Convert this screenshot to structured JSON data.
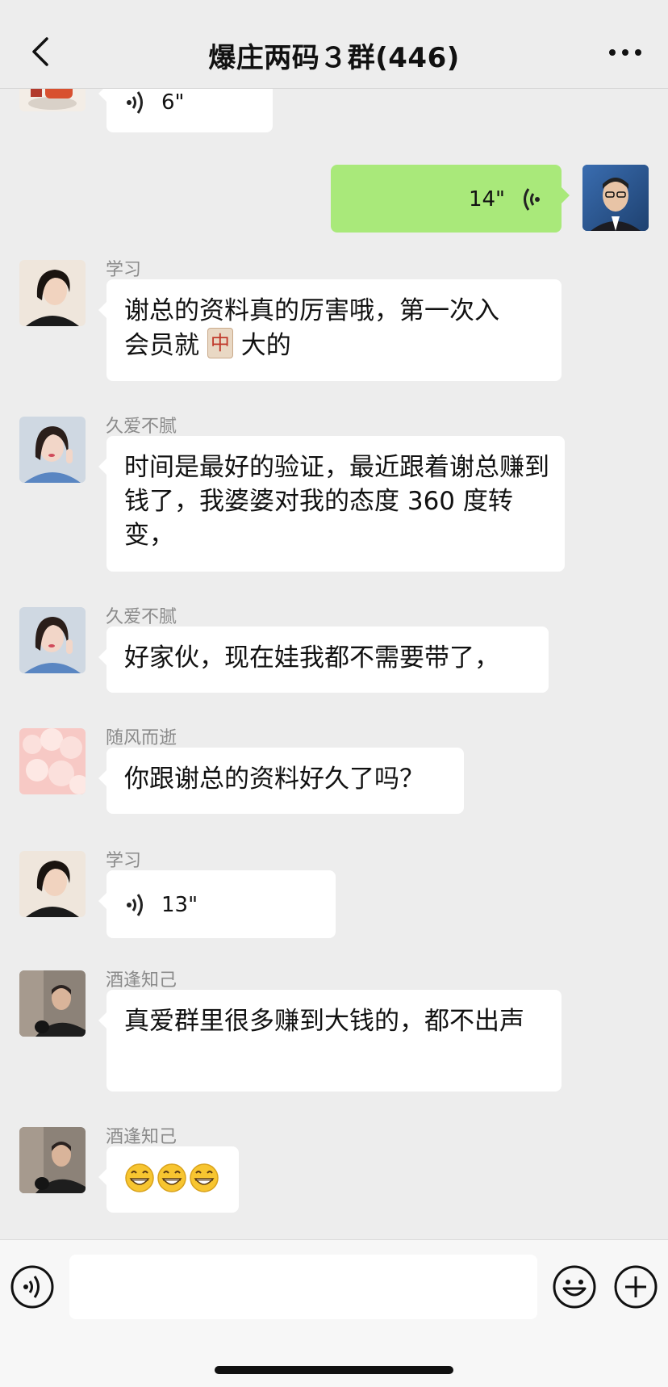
{
  "header": {
    "title": "爆庄两码３群(446)",
    "back_icon": "chevron-left-icon",
    "more_icon": "ellipsis-icon"
  },
  "messages": [
    {
      "type": "voice",
      "side": "left",
      "sender": "",
      "duration": "6\""
    },
    {
      "type": "voice",
      "side": "right",
      "sender": "",
      "duration": "14\""
    },
    {
      "type": "text",
      "side": "left",
      "sender": "学习",
      "line1": "谢总的资料真的厉害哦，第一次入",
      "line2_pre": "会员就",
      "tile": "中",
      "line2_post": "大的"
    },
    {
      "type": "text",
      "side": "left",
      "sender": "久爱不腻",
      "text": "时间是最好的验证，最近跟着谢总赚到钱了，我婆婆对我的态度 360 度转变，"
    },
    {
      "type": "text",
      "side": "left",
      "sender": "久爱不腻",
      "text": "好家伙，现在娃我都不需要带了，"
    },
    {
      "type": "text",
      "side": "left",
      "sender": "随风而逝",
      "text": "你跟谢总的资料好久了吗？"
    },
    {
      "type": "voice",
      "side": "left",
      "sender": "学习",
      "duration": "13\""
    },
    {
      "type": "text",
      "side": "left",
      "sender": "酒逢知己",
      "text": "真爱群里很多赚到大钱的，都不出声"
    },
    {
      "type": "emoji",
      "side": "left",
      "sender": "酒逢知己",
      "emoji": [
        "grinning-face",
        "grinning-face",
        "grinning-face"
      ]
    }
  ],
  "input_bar": {
    "value": "",
    "voice_icon": "voice-toggle-icon",
    "emoji_icon": "emoji-icon",
    "plus_icon": "plus-icon"
  },
  "colors": {
    "background": "#ededed",
    "bubble_self": "#a9e97a",
    "bubble_other": "#ffffff",
    "sender_name": "#8a8a8a"
  }
}
